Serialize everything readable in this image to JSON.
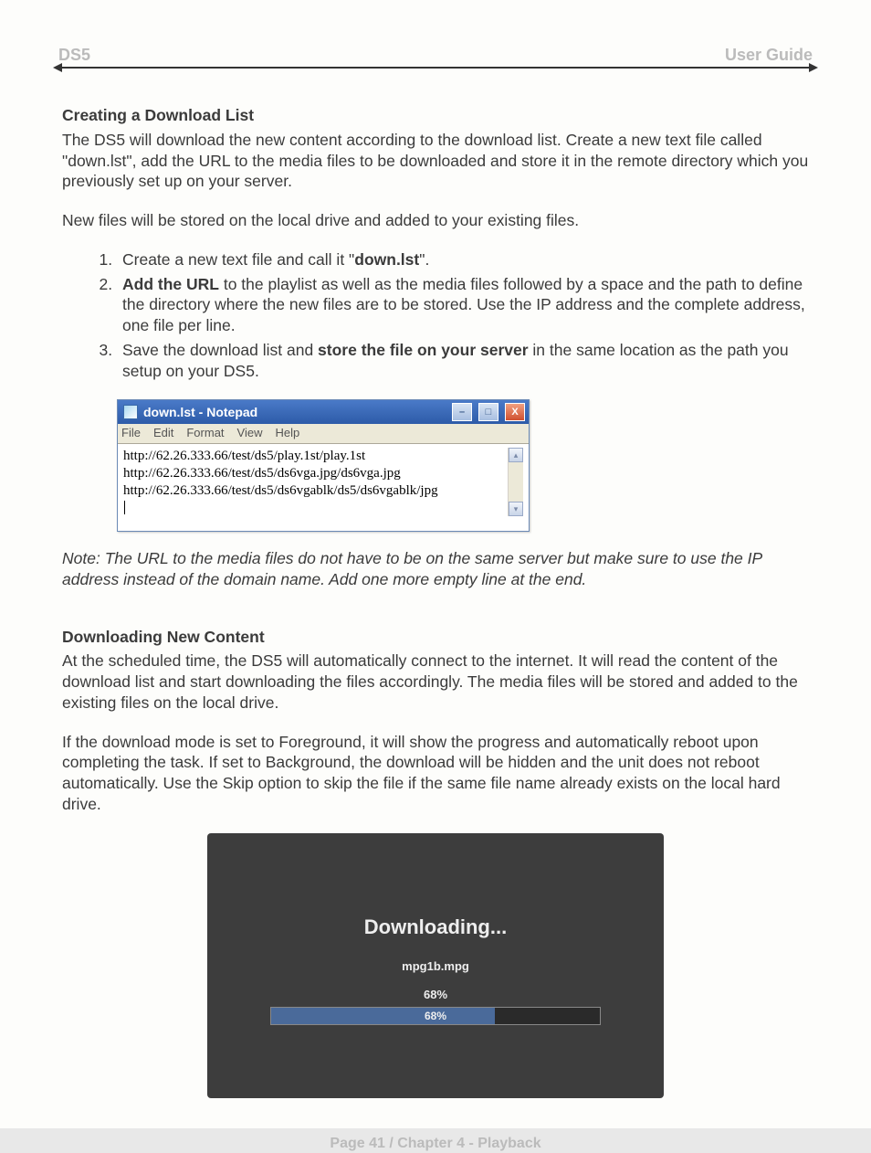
{
  "header": {
    "left": "DS5",
    "right": "User Guide"
  },
  "section1": {
    "title": "Creating a Download List",
    "p1": "The DS5 will download the new content according to the download list. Create a new text file called \"down.lst\", add the URL to the media files to be downloaded and store it in the remote directory which you previously set up on your server.",
    "p2": "New files will be stored on the local drive and added to your existing files.",
    "li1_a": "Create a new text file and call it \"",
    "li1_b": "down.lst",
    "li1_c": "\".",
    "li2_a": "Add the URL",
    "li2_b": " to the playlist as well as the media files followed by a space and the path to define the directory where the new files are to be stored. Use the IP address and the complete address, one file per line.",
    "li3_a": "Save the download list and ",
    "li3_b": "store the file on your server",
    "li3_c": " in the same location as the path you setup on your DS5."
  },
  "notepad": {
    "title": "down.lst - Notepad",
    "menu": [
      "File",
      "Edit",
      "Format",
      "View",
      "Help"
    ],
    "lines": [
      "http://62.26.333.66/test/ds5/play.1st/play.1st",
      "http://62.26.333.66/test/ds5/ds6vga.jpg/ds6vga.jpg",
      "http://62.26.333.66/test/ds5/ds6vgablk/ds5/ds6vgablk/jpg"
    ],
    "win_min": "–",
    "win_max": "□",
    "win_close": "X",
    "scroll_up": "▴",
    "scroll_down": "▾"
  },
  "note_text": "Note: The URL to the media files do not have to be on the same server but make sure to use the IP address instead of the domain name. Add one more empty line at the end.",
  "section2": {
    "title": "Downloading New Content",
    "p1": "At the scheduled time, the DS5 will automatically connect to the internet. It will read the content of the download list and start downloading the files accordingly. The media files will be stored and added to the existing files on the local drive.",
    "p2": "If the download mode is set to Foreground, it will show the progress and automatically reboot upon completing the task. If set to Background, the download will be hidden and the unit does not reboot automatically. Use the Skip option to skip the file if the same file name already exists on the local hard drive."
  },
  "download": {
    "title": "Downloading...",
    "file": "mpg1b.mpg",
    "pct_text": "68%",
    "bar_text": "68%"
  },
  "footer": "Page 41  /  Chapter 4 - Playback"
}
